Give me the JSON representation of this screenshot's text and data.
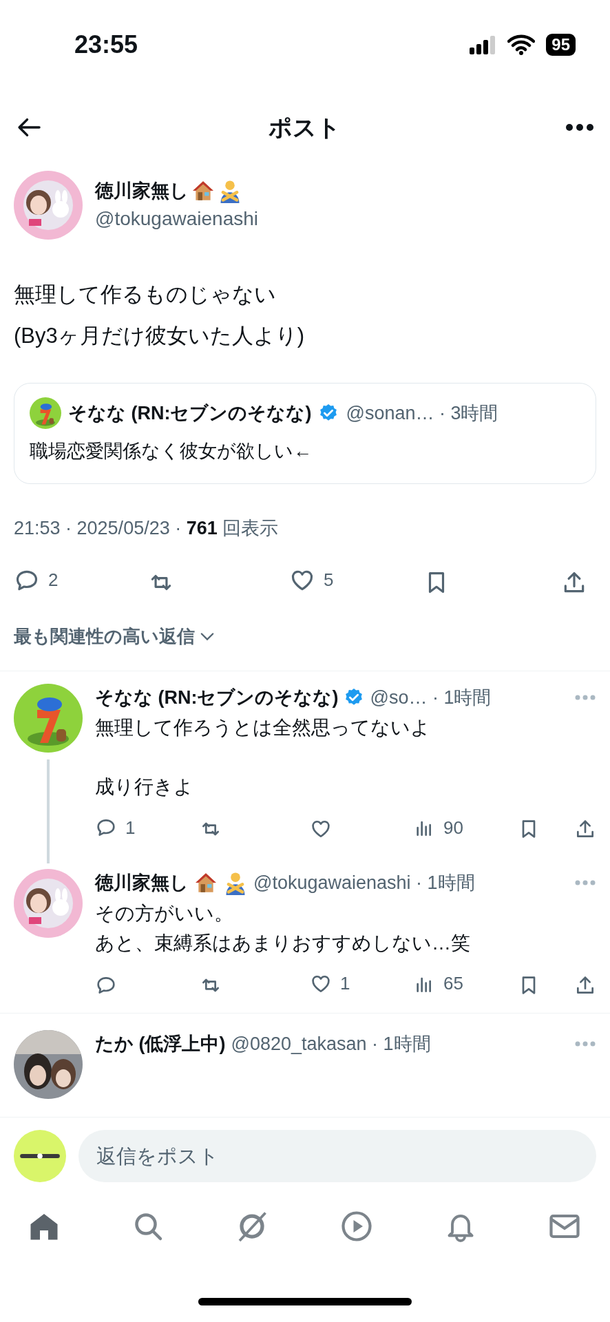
{
  "status_bar": {
    "time": "23:55",
    "battery": "95"
  },
  "header": {
    "title": "ポスト"
  },
  "post": {
    "author": {
      "name": "徳川家無し",
      "handle": "@tokugawaienashi"
    },
    "text": "無理して作るものじゃない\n(By3ヶ月だけ彼女いた人より)",
    "quote": {
      "name": "そなな (RN:セブンのそなな)",
      "verified": true,
      "meta": "@sonan… · 3時間",
      "text": "職場恋愛関係なく彼女が欲しい←"
    },
    "stats": "21:53 · 2025/05/23 · **761** 回表示",
    "actions": [
      {
        "kind": "reply",
        "count": "2"
      },
      {
        "kind": "repost"
      },
      {
        "kind": "like",
        "count": "5"
      },
      {
        "kind": "bookmark"
      },
      {
        "kind": "share"
      }
    ]
  },
  "sort": {
    "label": "最も関連性の高い返信"
  },
  "replies": [
    {
      "kind": "quoted_author",
      "name": "そなな (RN:セブンのそなな)",
      "verified": true,
      "meta": "@so… · 1時間",
      "paragraphs": [
        [
          "無理して作ろうとは全然思ってないよ"
        ],
        [
          "成り行きよ"
        ]
      ],
      "thread": true,
      "actions": [
        {
          "kind": "reply",
          "count": "1"
        },
        {
          "kind": "repost"
        },
        {
          "kind": "like"
        },
        {
          "kind": "views",
          "count": "90"
        },
        {
          "kind": "bookmark"
        },
        {
          "kind": "share"
        }
      ]
    },
    {
      "kind": "post_author",
      "name": "徳川家無し",
      "verified": false,
      "meta": "@tokugawaienashi · 1時間",
      "paragraphs": [
        [
          "その方がいい。",
          "あと、束縛系はあまりおすすめしない…笑"
        ]
      ],
      "thread": false,
      "actions": [
        {
          "kind": "reply"
        },
        {
          "kind": "repost"
        },
        {
          "kind": "like",
          "count": "1"
        },
        {
          "kind": "views",
          "count": "65"
        },
        {
          "kind": "bookmark"
        },
        {
          "kind": "share"
        }
      ]
    },
    {
      "kind": "other",
      "name": "たか (低浮上中)",
      "verified": false,
      "meta": "@0820_takasan · 1時間",
      "thread": false
    }
  ],
  "composer": {
    "placeholder": "返信をポスト"
  },
  "tab_bar": [
    {
      "kind": "home",
      "selected": true
    },
    {
      "kind": "search",
      "selected": false
    },
    {
      "kind": "grok",
      "selected": false
    },
    {
      "kind": "video",
      "selected": false
    },
    {
      "kind": "notifications",
      "selected": false
    },
    {
      "kind": "messages",
      "selected": false
    }
  ]
}
